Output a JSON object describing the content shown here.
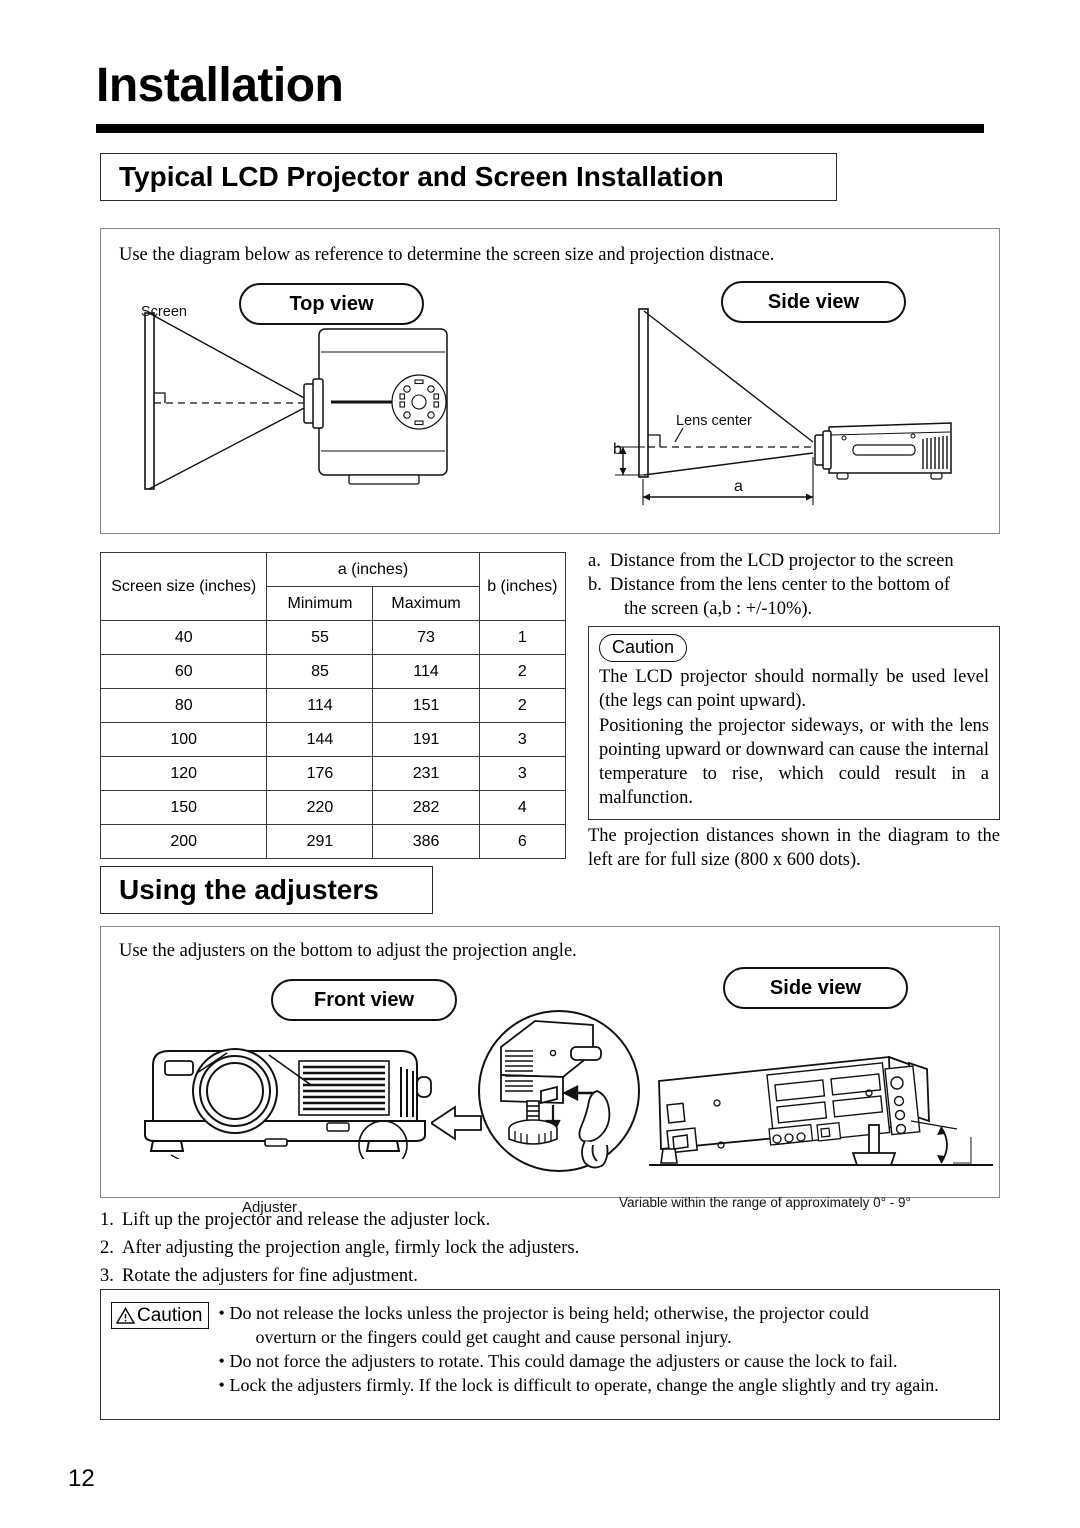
{
  "page": {
    "title": "Installation",
    "page_number": "12"
  },
  "section_typical": {
    "heading": "Typical LCD Projector and Screen Installation",
    "intro": "Use the diagram below as reference to determine the screen size and projection distnace.",
    "diagram": {
      "top_view_label": "Top view",
      "side_view_label": "Side view",
      "screen_label": "Screen",
      "lens_center_label": "Lens center",
      "dim_a_label": "a",
      "dim_b_label": "b"
    },
    "table": {
      "headers": {
        "screen_size": "Screen size (inches)",
        "a_group": "a (inches)",
        "minimum": "Minimum",
        "maximum": "Maximum",
        "b": "b (inches)"
      },
      "rows": [
        {
          "screen_size": "40",
          "a_min": "55",
          "a_max": "73",
          "b": "1"
        },
        {
          "screen_size": "60",
          "a_min": "85",
          "a_max": "114",
          "b": "2"
        },
        {
          "screen_size": "80",
          "a_min": "114",
          "a_max": "151",
          "b": "2"
        },
        {
          "screen_size": "100",
          "a_min": "144",
          "a_max": "191",
          "b": "3"
        },
        {
          "screen_size": "120",
          "a_min": "176",
          "a_max": "231",
          "b": "3"
        },
        {
          "screen_size": "150",
          "a_min": "220",
          "a_max": "282",
          "b": "4"
        },
        {
          "screen_size": "200",
          "a_min": "291",
          "a_max": "386",
          "b": "6"
        }
      ]
    },
    "legend": {
      "a_key": "a.",
      "a_text": "Distance from the LCD projector to the screen",
      "b_key": "b.",
      "b_text": "Distance from the lens center to the bottom of",
      "b_text_cont": "the screen (a,b : +/-10%)."
    },
    "caution": {
      "label": "Caution",
      "paragraph1": "The LCD projector should normally be used level (the legs can point upward).",
      "paragraph2": "Positioning the projector sideways, or with the lens pointing upward or downward can cause the internal temperature to rise, which could result in a malfunction."
    },
    "note_after_caution": "The projection distances shown in the diagram to the left are for full size (800 x 600 dots)."
  },
  "section_adjusters": {
    "heading": "Using the adjusters",
    "intro": "Use the adjusters on the bottom to adjust the projection angle.",
    "diagram": {
      "front_view_label": "Front view",
      "side_view_label": "Side view",
      "adjuster_label": "Adjuster",
      "angle_note": "Variable within the range of approximately 0° - 9°"
    },
    "steps": [
      {
        "num": "1.",
        "text": "Lift up the projector and release the adjuster lock."
      },
      {
        "num": "2.",
        "text": "After adjusting the projection angle, firmly lock the adjusters."
      },
      {
        "num": "3.",
        "text": "Rotate the adjusters for fine adjustment."
      }
    ],
    "caution": {
      "label": "Caution",
      "bullets": [
        {
          "line1": "Do not release the locks unless the projector is being held; otherwise, the projector could",
          "line2": "overturn or the fingers could get caught and cause personal injury."
        },
        {
          "line1": "Do not force the adjusters to rotate. This could damage the adjusters or cause the lock to fail.",
          "line2": ""
        },
        {
          "line1": "Lock the adjusters firmly. If the lock is difficult to operate, change the angle slightly and try again.",
          "line2": ""
        }
      ]
    }
  }
}
